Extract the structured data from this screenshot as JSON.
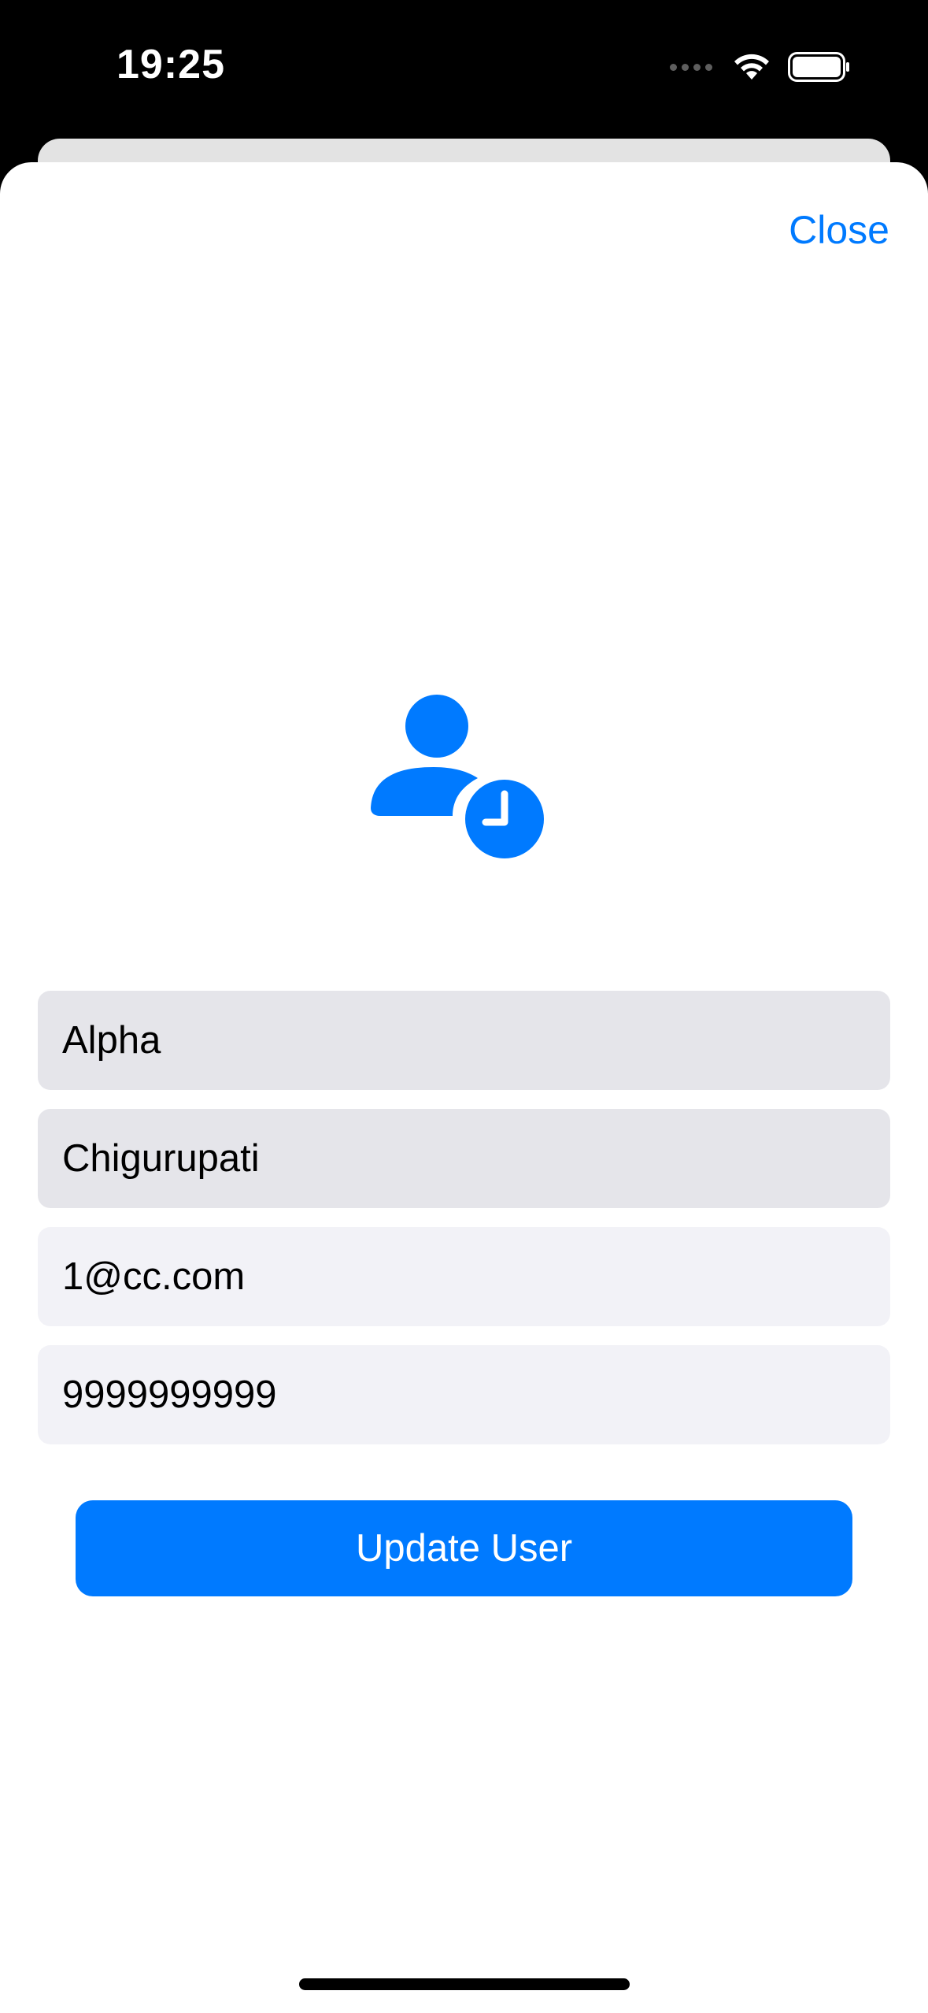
{
  "status_bar": {
    "time": "19:25",
    "icons": [
      "cellular-signal-icon",
      "wifi-icon",
      "battery-icon"
    ]
  },
  "sheet": {
    "close_label": "Close",
    "header_icon": "person-clock-icon",
    "fields": [
      {
        "name": "first-name-field",
        "value": "Alpha"
      },
      {
        "name": "last-name-field",
        "value": "Chigurupati"
      },
      {
        "name": "email-field",
        "value": "1@cc.com"
      },
      {
        "name": "phone-field",
        "value": "9999999999"
      }
    ],
    "update_label": "Update User"
  },
  "colors": {
    "accent": "#007aff",
    "field_disabled": "#e5e5ea",
    "field_enabled": "#f2f2f7"
  }
}
